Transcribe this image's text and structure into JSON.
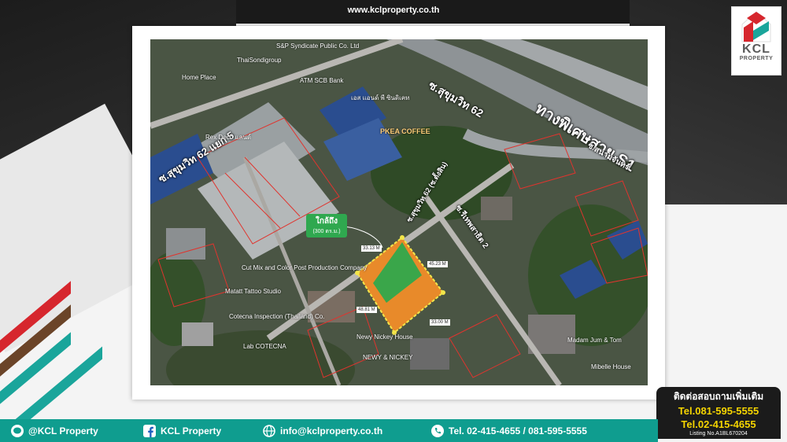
{
  "header": {
    "site_url": "www.kclproperty.co.th"
  },
  "logo": {
    "name": "KCL",
    "subtitle": "PROPERTY"
  },
  "map": {
    "road_labels": {
      "highway": "ทางพิเศษสาย S1",
      "soi62": "ซ.สุขุมวิท 62",
      "soi62_5": "ซ.สุขุมวิท 62 แยก 5",
      "sanam": "ซ.สนามจันทร์",
      "road2": "ซ.รีเทพสาธิต 2",
      "road1": "ซ.สุขุมวิท 62 (ซ.ตั้งสิน)"
    },
    "poi": {
      "sp": "S&P Syndicate Public Co. Ltd",
      "thai_sondi": "ThaiSondigroup",
      "home_place": "Home Place",
      "atm": "ATM SCB Bank",
      "spsyn": "เอส แอนด์ พี ซินดิเคท",
      "tesco": "Rex Deco แลนด์",
      "pkea": "PKEA COFFEE",
      "cut": "Cut Mix and Color Post Production Company",
      "matatt": "Matatt Tattoo Studio",
      "cotecna": "Cotecna Inspection (Thailand) Co.",
      "lab": "Lab COTECNA",
      "newnickey": "Newy Nickey House",
      "newnickey2": "NEWY & NICKEY",
      "madam": "Madam Jum & Tom",
      "mibelle": "Mibelle House"
    },
    "distance_tag": {
      "main": "ใกล้ถึง",
      "sub": "(300 ตร.ม.)"
    },
    "dimensions": [
      "33.13 M",
      "45.23 M",
      "48.81 M",
      "33.00 M"
    ]
  },
  "contact": {
    "title": "ติดต่อสอบถามเพิ่มเติม",
    "tel1": "Tel.081-595-5555",
    "tel2": "Tel.02-415-4655",
    "listing": "Listing No.A1BL670204"
  },
  "footer": {
    "line": "@KCL Property",
    "facebook": "KCL Property",
    "email": "info@kclproperty.co.th",
    "phone": "Tel. 02-415-4655 / 081-595-5555"
  },
  "colors": {
    "teal": "#0f9d8f",
    "red": "#d6262d",
    "brown": "#6b4428",
    "parcel_orange": "#e88a2a",
    "parcel_green": "#3aa64a",
    "tel_yellow": "#f5d400"
  }
}
